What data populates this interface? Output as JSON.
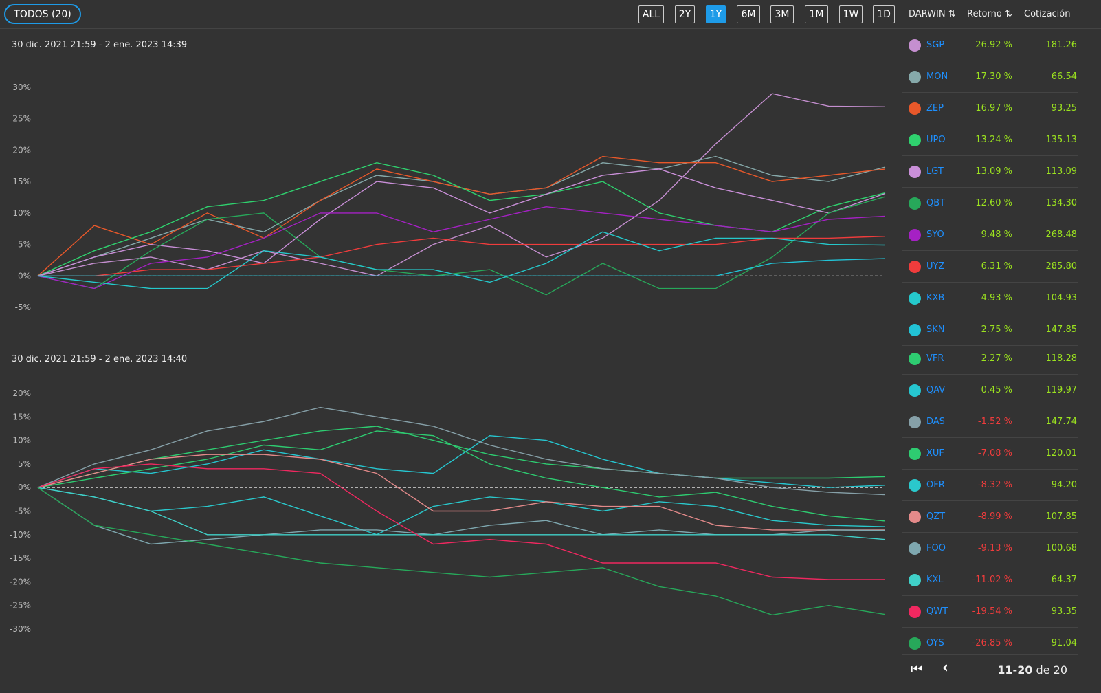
{
  "header": {
    "todos": "TODOS (20)",
    "ranges": [
      "ALL",
      "2Y",
      "1Y",
      "6M",
      "3M",
      "1M",
      "1W",
      "1D"
    ],
    "active": "1Y"
  },
  "panel": {
    "col_darwin": "DARWIN ⇅",
    "col_retorno": "Retorno ⇅",
    "col_cotizacion": "Cotización",
    "rows": [
      {
        "name": "SGP",
        "color": "#c58fd0",
        "ret": "26.92 %",
        "price": "181.26"
      },
      {
        "name": "MON",
        "color": "#86a9aa",
        "ret": "17.30 %",
        "price": "66.54"
      },
      {
        "name": "ZEP",
        "color": "#e8582a",
        "ret": "16.97 %",
        "price": "93.25"
      },
      {
        "name": "UPO",
        "color": "#2fd16e",
        "ret": "13.24 %",
        "price": "135.13"
      },
      {
        "name": "LGT",
        "color": "#c98fd8",
        "ret": "13.09 %",
        "price": "113.09"
      },
      {
        "name": "QBT",
        "color": "#27a85a",
        "ret": "12.60 %",
        "price": "134.30"
      },
      {
        "name": "SYO",
        "color": "#a521c4",
        "ret": "9.48 %",
        "price": "268.48"
      },
      {
        "name": "UYZ",
        "color": "#f03c3c",
        "ret": "6.31 %",
        "price": "285.80"
      },
      {
        "name": "KXB",
        "color": "#25c9cc",
        "ret": "4.93 %",
        "price": "104.93"
      },
      {
        "name": "SKN",
        "color": "#22c3d6",
        "ret": "2.75 %",
        "price": "147.85"
      },
      {
        "name": "VFR",
        "color": "#2ecc71",
        "ret": "2.27 %",
        "price": "118.28"
      },
      {
        "name": "QAV",
        "color": "#26c6d0",
        "ret": "0.45 %",
        "price": "119.97"
      },
      {
        "name": "DAS",
        "color": "#86a0a8",
        "ret": "-1.52 %",
        "price": "147.74"
      },
      {
        "name": "XUF",
        "color": "#2ecc71",
        "ret": "-7.08 %",
        "price": "120.01"
      },
      {
        "name": "OFR",
        "color": "#2ac8cc",
        "ret": "-8.32 %",
        "price": "94.20"
      },
      {
        "name": "QZT",
        "color": "#e48a8a",
        "ret": "-8.99 %",
        "price": "107.85"
      },
      {
        "name": "FOO",
        "color": "#7fa8b0",
        "ret": "-9.13 %",
        "price": "100.68"
      },
      {
        "name": "KXL",
        "color": "#40d0c8",
        "ret": "-11.02 %",
        "price": "64.37"
      },
      {
        "name": "QWT",
        "color": "#f02860",
        "ret": "-19.54 %",
        "price": "93.35"
      },
      {
        "name": "OYS",
        "color": "#27a85a",
        "ret": "-26.85 %",
        "price": "91.04"
      }
    ],
    "pager": {
      "range": "11-20",
      "of": "de 20"
    }
  },
  "chart_data": [
    {
      "type": "line",
      "title": "30 dic. 2021 21:59 - 2 ene. 2023 14:39",
      "yticks": [
        "30%",
        "25%",
        "20%",
        "15%",
        "10%",
        "5%",
        "0%",
        "-5%"
      ],
      "ylim": [
        -5,
        30
      ],
      "series": [
        {
          "name": "SGP",
          "color": "#c58fd0",
          "values": [
            0,
            2,
            3,
            1,
            4,
            2,
            0,
            5,
            8,
            3,
            6,
            12,
            21,
            29,
            27,
            26.9
          ]
        },
        {
          "name": "MON",
          "color": "#86a9aa",
          "values": [
            0,
            3,
            6,
            9,
            7,
            12,
            16,
            15,
            13,
            14,
            18,
            17,
            19,
            16,
            15,
            17.3
          ]
        },
        {
          "name": "ZEP",
          "color": "#e8582a",
          "values": [
            0,
            8,
            5,
            10,
            6,
            12,
            17,
            15,
            13,
            14,
            19,
            18,
            18,
            15,
            16,
            17
          ]
        },
        {
          "name": "UPO",
          "color": "#2fd16e",
          "values": [
            0,
            4,
            7,
            11,
            12,
            15,
            18,
            16,
            12,
            13,
            15,
            10,
            8,
            7,
            11,
            13.2
          ]
        },
        {
          "name": "LGT",
          "color": "#c98fd8",
          "values": [
            0,
            3,
            5,
            4,
            2,
            9,
            15,
            14,
            10,
            13,
            16,
            17,
            14,
            12,
            10,
            13.1
          ]
        },
        {
          "name": "QBT",
          "color": "#27a85a",
          "values": [
            0,
            -2,
            4,
            9,
            10,
            3,
            1,
            0,
            1,
            -3,
            2,
            -2,
            -2,
            3,
            10,
            12.6
          ]
        },
        {
          "name": "SYO",
          "color": "#a521c4",
          "values": [
            0,
            -2,
            2,
            3,
            6,
            10,
            10,
            7,
            9,
            11,
            10,
            9,
            8,
            7,
            9,
            9.5
          ]
        },
        {
          "name": "UYZ",
          "color": "#f03c3c",
          "values": [
            0,
            0,
            1,
            1,
            2,
            3,
            5,
            6,
            5,
            5,
            5,
            5,
            5,
            6,
            6,
            6.3
          ]
        },
        {
          "name": "KXB",
          "color": "#25c9cc",
          "values": [
            0,
            -1,
            -2,
            -2,
            4,
            3,
            1,
            1,
            -1,
            2,
            7,
            4,
            6,
            6,
            5,
            4.9
          ]
        },
        {
          "name": "SKN",
          "color": "#22c3d6",
          "values": [
            0,
            0,
            0,
            0,
            0,
            0,
            0,
            0,
            0,
            0,
            0,
            0,
            0,
            2,
            2.5,
            2.75
          ]
        }
      ]
    },
    {
      "type": "line",
      "title": "30 dic. 2021 21:59 - 2 ene. 2023 14:40",
      "yticks": [
        "20%",
        "15%",
        "10%",
        "5%",
        "0%",
        "-5%",
        "-10%",
        "-15%",
        "-20%",
        "-25%",
        "-30%"
      ],
      "ylim": [
        -30,
        20
      ],
      "series": [
        {
          "name": "VFR",
          "color": "#2ecc71",
          "values": [
            0,
            3,
            6,
            8,
            10,
            12,
            13,
            10,
            7,
            5,
            4,
            3,
            2,
            2,
            2,
            2.3
          ]
        },
        {
          "name": "QAV",
          "color": "#26c6d0",
          "values": [
            0,
            4,
            3,
            5,
            8,
            6,
            4,
            3,
            11,
            10,
            6,
            3,
            2,
            1,
            0,
            0.5
          ]
        },
        {
          "name": "DAS",
          "color": "#86a0a8",
          "values": [
            0,
            5,
            8,
            12,
            14,
            17,
            15,
            13,
            9,
            6,
            4,
            3,
            2,
            0,
            -1,
            -1.5
          ]
        },
        {
          "name": "XUF",
          "color": "#2ecc71",
          "values": [
            0,
            2,
            4,
            6,
            9,
            8,
            12,
            11,
            5,
            2,
            0,
            -2,
            -1,
            -4,
            -6,
            -7.1
          ]
        },
        {
          "name": "OFR",
          "color": "#2ac8cc",
          "values": [
            0,
            -2,
            -5,
            -4,
            -2,
            -6,
            -10,
            -4,
            -2,
            -3,
            -5,
            -3,
            -4,
            -7,
            -8,
            -8.3
          ]
        },
        {
          "name": "QZT",
          "color": "#e48a8a",
          "values": [
            0,
            3,
            6,
            7,
            7,
            6,
            3,
            -5,
            -5,
            -3,
            -4,
            -4,
            -8,
            -9,
            -9,
            -9
          ]
        },
        {
          "name": "FOO",
          "color": "#7fa8b0",
          "values": [
            0,
            -8,
            -12,
            -11,
            -10,
            -9,
            -9,
            -10,
            -8,
            -7,
            -10,
            -9,
            -10,
            -10,
            -9,
            -9.1
          ]
        },
        {
          "name": "KXL",
          "color": "#40d0c8",
          "values": [
            0,
            -2,
            -5,
            -10,
            -10,
            -10,
            -10,
            -10,
            -10,
            -10,
            -10,
            -10,
            -10,
            -10,
            -10,
            -11
          ]
        },
        {
          "name": "QWT",
          "color": "#f02860",
          "values": [
            0,
            4,
            5,
            4,
            4,
            3,
            -5,
            -12,
            -11,
            -12,
            -16,
            -16,
            -16,
            -19,
            -19.5,
            -19.5
          ]
        },
        {
          "name": "OYS",
          "color": "#27a85a",
          "values": [
            0,
            -8,
            -10,
            -12,
            -14,
            -16,
            -17,
            -18,
            -19,
            -18,
            -17,
            -21,
            -23,
            -27,
            -25,
            -26.9
          ]
        }
      ]
    }
  ]
}
